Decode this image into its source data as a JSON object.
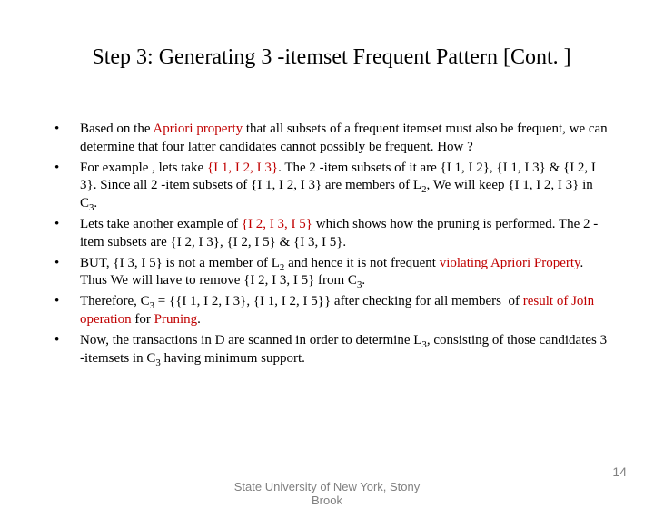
{
  "title": "Step 3: Generating 3 -itemset Frequent Pattern [Cont. ]",
  "bullets": [
    "Based on the <span class=\"red\">Apriori property</span> that all subsets of a frequent itemset must also be frequent, we can determine that four latter candidates cannot possibly be frequent. How ?",
    "For example , lets take <span class=\"red\">{I 1, I 2, I 3}</span>. The 2 -item subsets of it are {I 1, I 2}, {I 1, I 3} &amp; {I 2, I 3}. Since all 2 -item subsets of {I 1, I 2, I 3} are members of L<span class=\"sub\">2</span>, We will keep {I 1, I 2, I 3} in C<span class=\"sub\">3</span>.",
    "Lets take another example of <span class=\"red\">{I 2, I 3, I 5}</span> which shows how the pruning is performed. The 2 -item subsets are {I 2, I 3}, {I 2, I 5} &amp; {I 3, I 5}.",
    "BUT, {I 3, I 5} is not a member of L<span class=\"sub\">2</span> and hence it is not frequent <span class=\"red\">violating Apriori Property</span>. Thus We will have to remove {I 2, I 3, I 5} from C<span class=\"sub\">3</span>.",
    "Therefore, C<span class=\"sub\">3</span> = {{I 1, I 2, I 3}, {I 1, I 2, I 5}} after checking for all members&nbsp; of <span class=\"red\">result of Join operation</span> for <span class=\"red\">Pruning</span>.",
    "Now, the transactions in D are scanned in order to determine L<span class=\"sub\">3</span>, consisting of those candidates 3 -itemsets in C<span class=\"sub\">3</span> having minimum support."
  ],
  "footer": {
    "center_line1": "State University of New York, Stony",
    "center_line2": "Brook",
    "page": "14"
  }
}
